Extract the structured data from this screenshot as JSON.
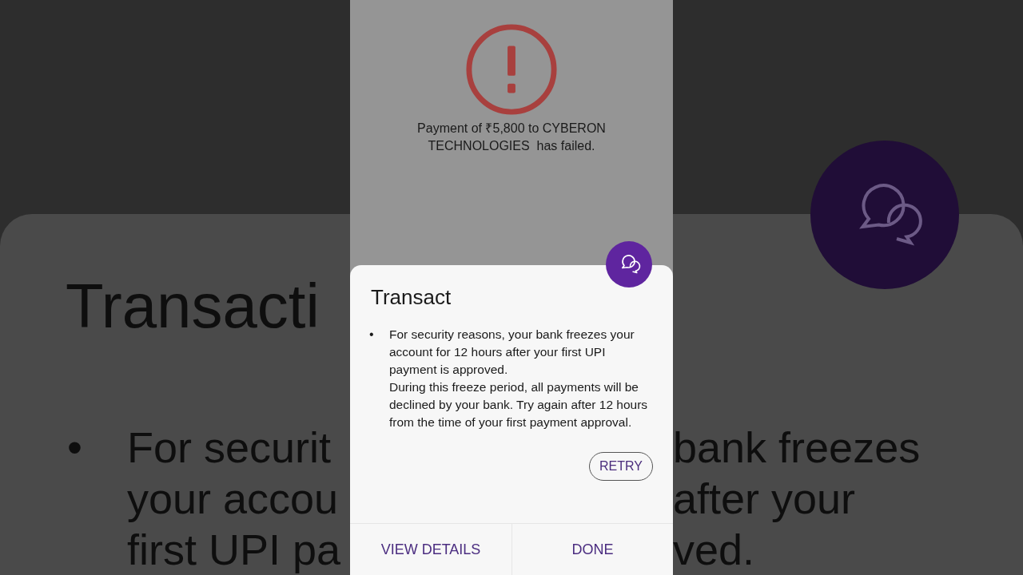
{
  "backdrop": {
    "title": "Transacti",
    "marker": "•",
    "left_lines": [
      "For securit",
      "your accou",
      "first UPI pa"
    ],
    "right_lines": [
      "bank freezes",
      "after your",
      "ved."
    ]
  },
  "status": {
    "kind": "error",
    "message": "Payment of ₹5,800 to CYBERON TECHNOLOGIES  has failed."
  },
  "sheet": {
    "title": "Transact",
    "bullets": [
      {
        "marker": "•",
        "lines": [
          "For security reasons, your bank freezes your account for 12 hours after your first UPI payment is approved.",
          "During this freeze period, all payments will be declined by your bank. Try again after 12 hours from the time of your first payment approval."
        ]
      }
    ],
    "retry": "RETRY",
    "actions": [
      "VIEW DETAILS",
      "DONE"
    ]
  }
}
